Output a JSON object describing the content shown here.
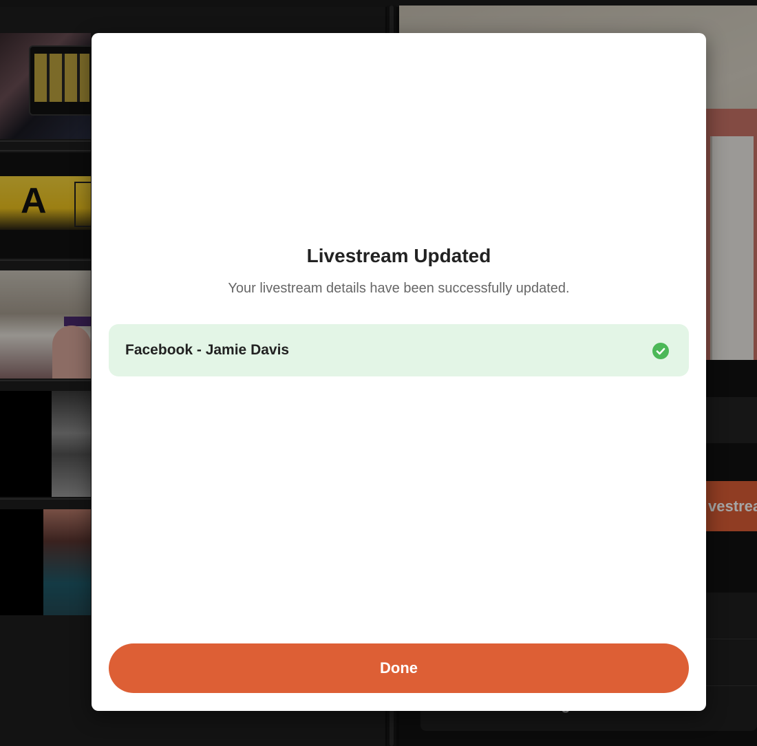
{
  "background": {
    "thumbnail_letter": "A",
    "right_panel_button_fragment": "vestrea",
    "right_panel_bottom_label": "Advanced Settings"
  },
  "modal": {
    "title": "Livestream Updated",
    "subtitle": "Your livestream details have been successfully updated.",
    "destinations": [
      {
        "label": "Facebook - Jamie Davis",
        "status_icon": "check-circle-icon",
        "status_color": "#4cb858"
      }
    ],
    "done_label": "Done"
  },
  "colors": {
    "accent": "#dd5f35",
    "success_bg": "#e3f5e6",
    "success_icon": "#4cb858"
  }
}
